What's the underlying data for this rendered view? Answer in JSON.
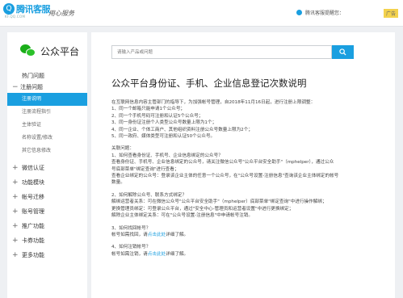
{
  "header": {
    "logo_mark": "Q",
    "logo_text": "腾讯客服",
    "logo_sub": "KF.QQ.COM",
    "slogan": "用心服务",
    "notice": "腾讯客服提醒您：",
    "ad_label": "广告"
  },
  "sidebar": {
    "title": "公众平台",
    "hot": "热门问题",
    "register_group": "注册问题",
    "register_items": [
      "注册说明",
      "注册流程指引",
      "主体验证",
      "名称设置/修改",
      "其它信息修改"
    ],
    "groups": [
      "微信认证",
      "功能模块",
      "帐号迁移",
      "账号管理",
      "推广功能",
      "卡券功能",
      "更多功能"
    ]
  },
  "search": {
    "placeholder": "请输入产品或问题"
  },
  "article": {
    "title": "公众平台身份证、手机、企业信息登记次数说明",
    "intro": [
      "在互联网信息内容主管部门的指导下，为加强帐号管理，自2018年11月16日起，进行注册上限调整：",
      "1、同一个邮箱只能申请1个公众号；",
      "2、同一个手机号码可注册和认证5个公众号；",
      "3、同一身份证注册个人类型公众号数量上限为1个；",
      "4、同一企业、个体工商户、其他组织资料注册公众号数量上限为2个；",
      "5、同一政府、媒体类型可注册和认证50个公众号。"
    ],
    "related_title": "关联问题：",
    "q1": "1、如何查看身份证、手机号、企业信息绑定的公众号？",
    "q1_lines": [
      "查看身份证、手机号、企业信息绑定的公众号，请关注微信公众号\"公众平台安全助手\"（mphelper），通过公众",
      "号底部菜单\"绑定查询\"进行查看；",
      "查看企业绑定的公众号：登录该企业主体的任意一个公众号，在\"公众号设置-注册信息\"查询该企业主体绑定的帐号",
      "数量。"
    ],
    "q2": "2、如何解除公众号、联系方式绑定？",
    "q2_lines": [
      "解绑运营者关系：可在微信公众号\"公众平台安全助手\"（mphelper）底部菜单\"绑定查询\"中进行操作解绑；",
      "更换管理员绑定：可登录公众平台，通过\"安全中心-管理员和运营者设置\"中进行更换绑定；",
      "解除企业主体绑定关系：可在\"公众号设置-注册信息\"中申请帐号注销。"
    ],
    "q3": "3、如何找回帐号？",
    "q3_pre": "帐号如需找回，请",
    "q3_link": "点击此处",
    "q3_post": "详细了解。",
    "q4": "4、如何注销帐号？",
    "q4_pre": "帐号如需注销，请",
    "q4_link": "点击此处",
    "q4_post": "详细了解。"
  },
  "colors": {
    "accent": "#1a9fe0",
    "wechat_green": "#1aad19"
  }
}
